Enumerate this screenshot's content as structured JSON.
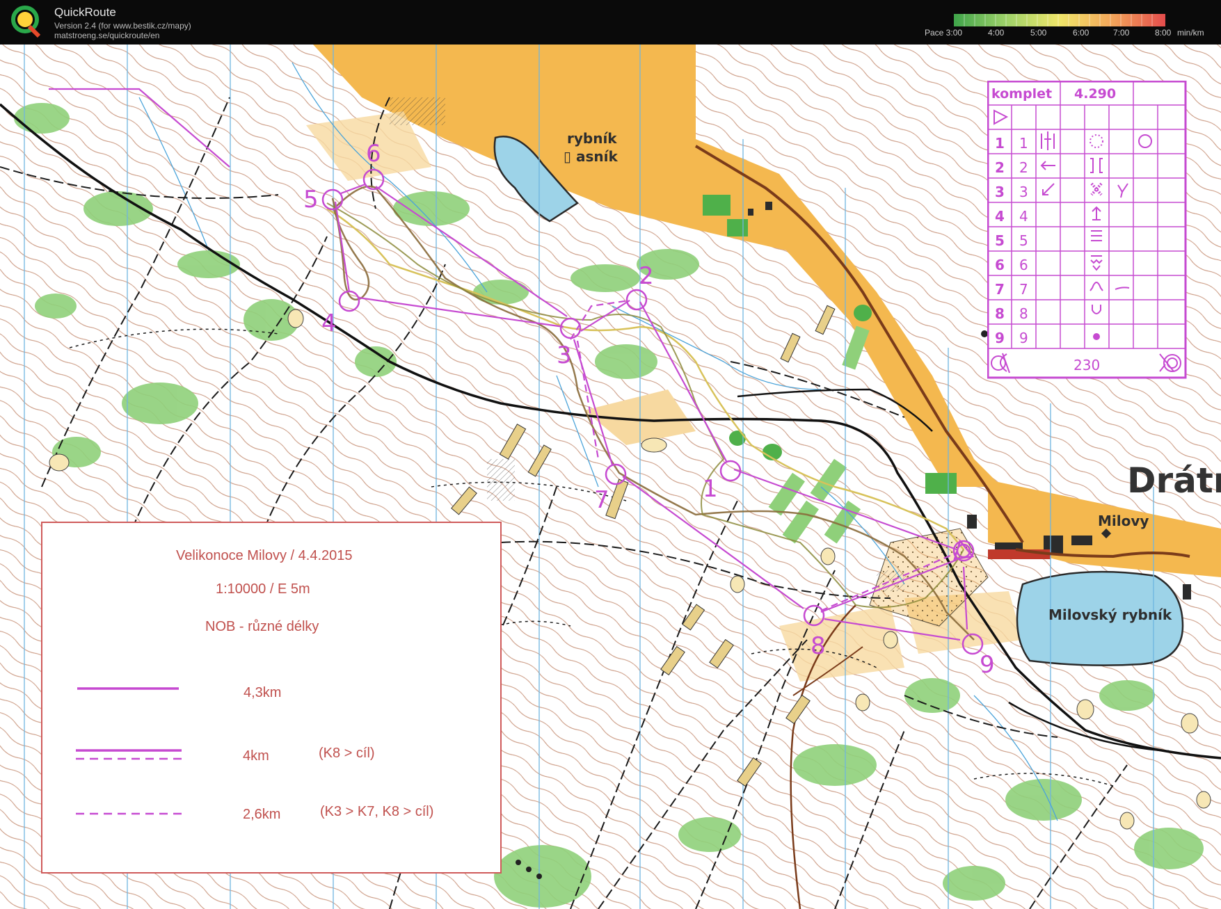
{
  "app": {
    "title": "QuickRoute",
    "version": "Version 2.4  (for www.bestik.cz/mapy)",
    "site": "matstroeng.se/quickroute/en"
  },
  "pace": {
    "ticks": [
      "Pace 3:00",
      "4:00",
      "5:00",
      "6:00",
      "7:00",
      "8:00",
      "min/km"
    ],
    "colors": [
      "#3fa44a",
      "#9fd36a",
      "#f0e66a",
      "#f3a55a",
      "#e34c4c"
    ]
  },
  "map": {
    "labels": {
      "pond_top": [
        "rybník",
        "▯ asník"
      ],
      "village": "Milovy",
      "pond_right": "Milovský rybník",
      "area_big": "Drátr"
    },
    "controls": [
      "1",
      "2",
      "3",
      "4",
      "5",
      "6",
      "7",
      "8",
      "9"
    ],
    "colors": {
      "course": "#c64ad1",
      "track": "#8a6a3a",
      "water": "#9dd3e8",
      "forest": "#8fd07a",
      "field": "#f4b84f",
      "contour": "#b5694a"
    }
  },
  "legend": {
    "event": "Velikonoce Milovy / 4.4.2015",
    "scale": "1:10000 / E 5m",
    "category": "NOB - různé délky",
    "courses": [
      {
        "distance": "4,3km",
        "note": ""
      },
      {
        "distance": "4km",
        "note": "(K8 > cíl)"
      },
      {
        "distance": "2,6km",
        "note": "(K3 > K7, K8 > cíl)"
      }
    ]
  },
  "description": {
    "course": "komplet",
    "length": "4.290",
    "rows": [
      {
        "num": "1",
        "code": "1"
      },
      {
        "num": "2",
        "code": "2"
      },
      {
        "num": "3",
        "code": "3"
      },
      {
        "num": "4",
        "code": "4"
      },
      {
        "num": "5",
        "code": "5"
      },
      {
        "num": "6",
        "code": "6"
      },
      {
        "num": "7",
        "code": "7"
      },
      {
        "num": "8",
        "code": "8"
      },
      {
        "num": "9",
        "code": "9"
      }
    ],
    "finish_distance": "230"
  }
}
